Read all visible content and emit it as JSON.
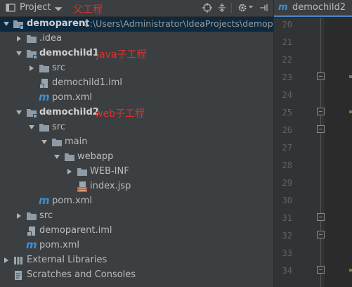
{
  "toolbar": {
    "view_label": "Project",
    "annotation": "父工程"
  },
  "tree": [
    {
      "label": "demoparent",
      "path": "C:\\Users\\Administrator\\IdeaProjects\\demoparent",
      "annotation": ""
    },
    {
      "label": ".idea",
      "annotation": ""
    },
    {
      "label": "demochild1",
      "annotation": "Java子工程"
    },
    {
      "label": "src",
      "annotation": ""
    },
    {
      "label": "demochild1.iml",
      "annotation": ""
    },
    {
      "label": "pom.xml",
      "annotation": ""
    },
    {
      "label": "demochild2",
      "annotation": "web子工程"
    },
    {
      "label": "src",
      "annotation": ""
    },
    {
      "label": "main",
      "annotation": ""
    },
    {
      "label": "webapp",
      "annotation": ""
    },
    {
      "label": "WEB-INF",
      "annotation": ""
    },
    {
      "label": "index.jsp",
      "annotation": ""
    },
    {
      "label": "pom.xml",
      "annotation": ""
    },
    {
      "label": "src",
      "annotation": ""
    },
    {
      "label": "demoparent.iml",
      "annotation": ""
    },
    {
      "label": "pom.xml",
      "annotation": ""
    },
    {
      "label": "External Libraries",
      "annotation": ""
    },
    {
      "label": "Scratches and Consoles",
      "annotation": ""
    }
  ],
  "editor": {
    "tab_icon_glyph": "m",
    "tab_label": "demochild2",
    "line_numbers": [
      "20",
      "21",
      "22",
      "23",
      "24",
      "25",
      "26",
      "27",
      "28",
      "29",
      "30",
      "31",
      "32",
      "33",
      "34"
    ]
  },
  "icons": {
    "project_view": "project-view-icon",
    "dropdown": "chevron-down-icon",
    "locate": "crosshair-icon",
    "collapse": "collapse-all-icon",
    "settings": "gear-icon",
    "hide": "hide-panel-icon",
    "folder": "folder-icon",
    "module": "module-folder-icon",
    "maven": "maven-icon",
    "iml": "iml-file-icon",
    "jsp": "jsp-file-icon",
    "libraries": "libraries-icon",
    "scratches": "scratches-icon"
  },
  "colors": {
    "panel_bg": "#3c3f41",
    "selected_row": "#0d293e",
    "annotation": "#e0302a",
    "folder": "#8e9ba6",
    "maven": "#3a8fd6",
    "editor_bg": "#2b2b2b"
  }
}
